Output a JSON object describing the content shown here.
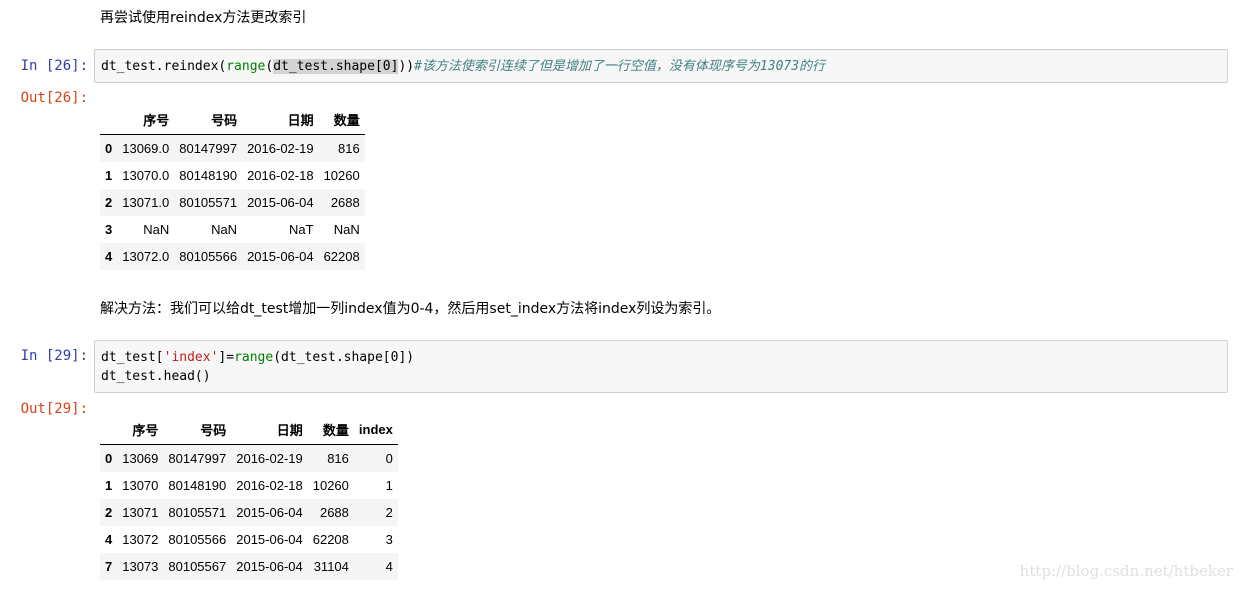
{
  "markdown1": "再尝试使用reindex方法更改索引",
  "cell1": {
    "in_prompt": "In [26]:",
    "out_prompt": "Out[26]:",
    "code": {
      "a": "dt_test.reindex(",
      "b": "range",
      "c": "(",
      "d": "dt_test.shape[0]",
      "e": "))",
      "comment": "#该方法使索引连续了但是增加了一行空值，没有体现序号为13073的行"
    },
    "table": {
      "columns": [
        "",
        "序号",
        "号码",
        "日期",
        "数量"
      ],
      "rows": [
        {
          "idx": "0",
          "c1": "13069.0",
          "c2": "80147997",
          "c3": "2016-02-19",
          "c4": "816"
        },
        {
          "idx": "1",
          "c1": "13070.0",
          "c2": "80148190",
          "c3": "2016-02-18",
          "c4": "10260"
        },
        {
          "idx": "2",
          "c1": "13071.0",
          "c2": "80105571",
          "c3": "2015-06-04",
          "c4": "2688"
        },
        {
          "idx": "3",
          "c1": "NaN",
          "c2": "NaN",
          "c3": "NaT",
          "c4": "NaN"
        },
        {
          "idx": "4",
          "c1": "13072.0",
          "c2": "80105566",
          "c3": "2015-06-04",
          "c4": "62208"
        }
      ]
    }
  },
  "markdown2": "解决方法：我们可以给dt_test增加一列index值为0-4，然后用set_index方法将index列设为索引。",
  "cell2": {
    "in_prompt": "In [29]:",
    "out_prompt": "Out[29]:",
    "code": {
      "l1a": "dt_test[",
      "l1b": "'index'",
      "l1c": "]=",
      "l1d": "range",
      "l1e": "(dt_test.shape[0])",
      "l2": "dt_test.head()"
    },
    "table": {
      "columns": [
        "",
        "序号",
        "号码",
        "日期",
        "数量",
        "index"
      ],
      "rows": [
        {
          "idx": "0",
          "c1": "13069",
          "c2": "80147997",
          "c3": "2016-02-19",
          "c4": "816",
          "c5": "0"
        },
        {
          "idx": "1",
          "c1": "13070",
          "c2": "80148190",
          "c3": "2016-02-18",
          "c4": "10260",
          "c5": "1"
        },
        {
          "idx": "2",
          "c1": "13071",
          "c2": "80105571",
          "c3": "2015-06-04",
          "c4": "2688",
          "c5": "2"
        },
        {
          "idx": "4",
          "c1": "13072",
          "c2": "80105566",
          "c3": "2015-06-04",
          "c4": "62208",
          "c5": "3"
        },
        {
          "idx": "7",
          "c1": "13073",
          "c2": "80105567",
          "c3": "2015-06-04",
          "c4": "31104",
          "c5": "4"
        }
      ]
    }
  },
  "watermark": "http://blog.csdn.net/htbeker",
  "colors": {
    "in_prompt": "#303F9F",
    "out_prompt": "#D84315",
    "builtin": "#008000",
    "string": "#BA2121",
    "comment": "#408080"
  }
}
